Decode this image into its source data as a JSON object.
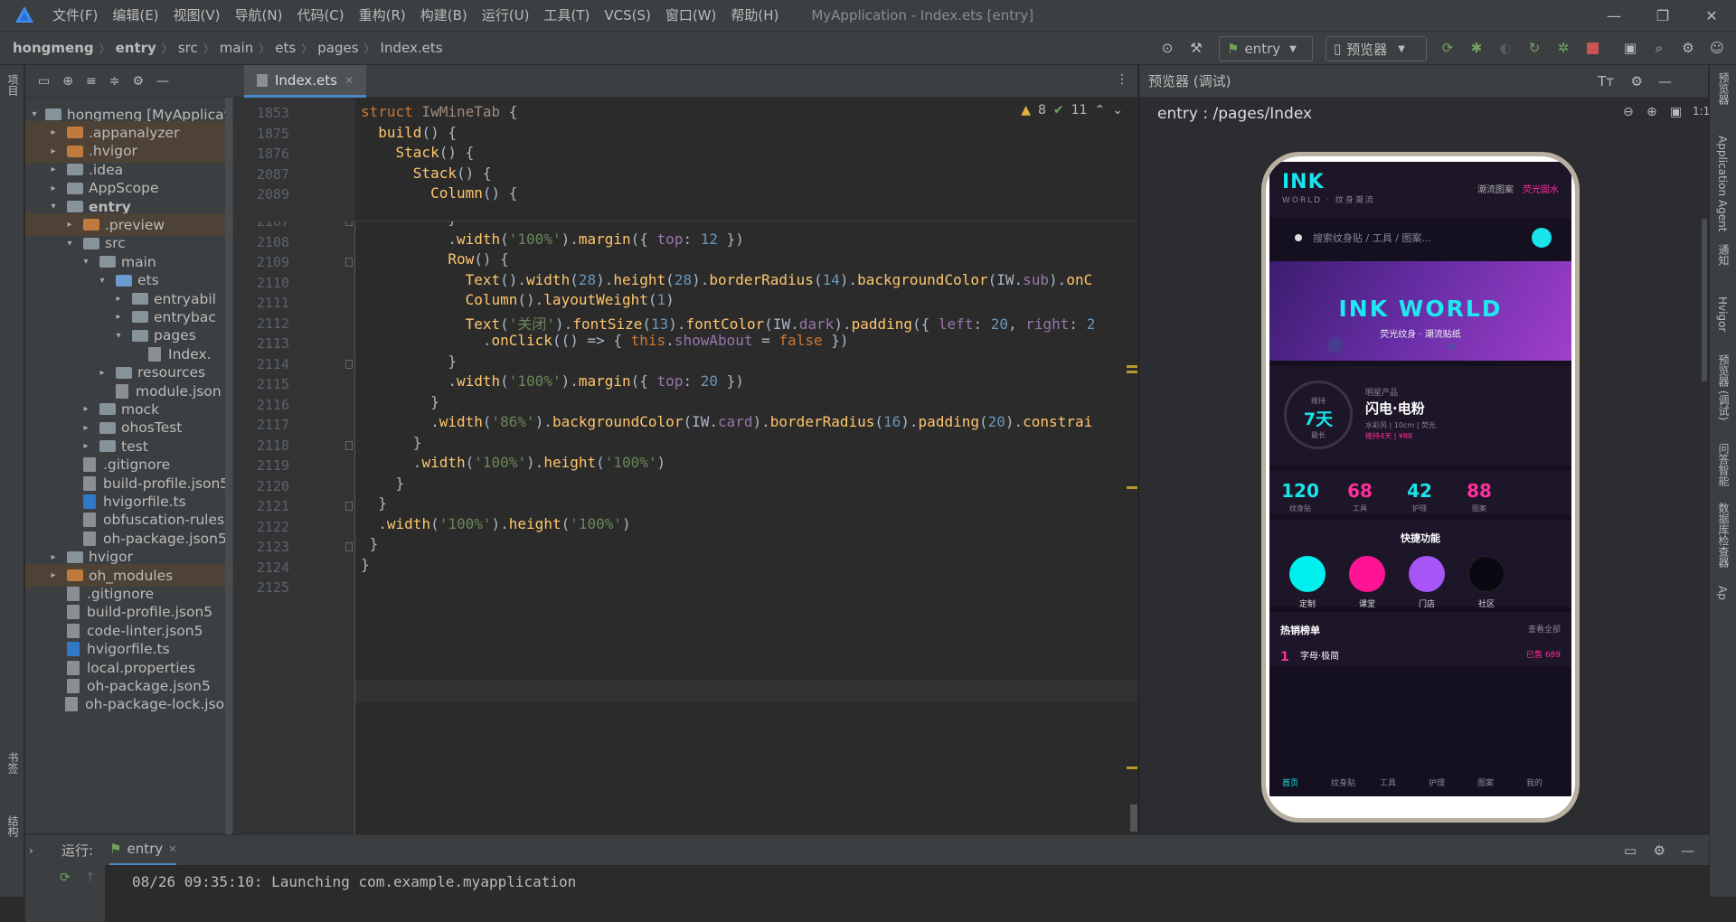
{
  "menubar": {
    "items": [
      "文件(F)",
      "编辑(E)",
      "视图(V)",
      "导航(N)",
      "代码(C)",
      "重构(R)",
      "构建(B)",
      "运行(U)",
      "工具(T)",
      "VCS(S)",
      "窗口(W)",
      "帮助(H)"
    ],
    "window_title": "MyApplication - Index.ets [entry]"
  },
  "breadcrumb": [
    "hongmeng",
    "entry",
    "src",
    "main",
    "ets",
    "pages",
    "Index.ets"
  ],
  "toolbar": {
    "config": "entry",
    "device": "预览器"
  },
  "left_strip": {
    "project": "项目",
    "bookmarks": "书签",
    "structure": "结构"
  },
  "project_tree": [
    {
      "depth": 0,
      "arrow": "▾",
      "type": "folder",
      "label": "hongmeng [MyApplicati"
    },
    {
      "depth": 1,
      "arrow": "▸",
      "type": "folder-orange",
      "label": ".appanalyzer",
      "hl": true
    },
    {
      "depth": 1,
      "arrow": "▸",
      "type": "folder-orange",
      "label": ".hvigor",
      "hl": true
    },
    {
      "depth": 1,
      "arrow": "▸",
      "type": "folder",
      "label": ".idea"
    },
    {
      "depth": 1,
      "arrow": "▸",
      "type": "folder",
      "label": "AppScope"
    },
    {
      "depth": 1,
      "arrow": "▾",
      "type": "folder",
      "label": "entry",
      "bold": true
    },
    {
      "depth": 2,
      "arrow": "▸",
      "type": "folder-orange",
      "label": ".preview",
      "hl": true
    },
    {
      "depth": 2,
      "arrow": "▾",
      "type": "folder",
      "label": "src"
    },
    {
      "depth": 3,
      "arrow": "▾",
      "type": "folder",
      "label": "main"
    },
    {
      "depth": 4,
      "arrow": "▾",
      "type": "folder-blue",
      "label": "ets"
    },
    {
      "depth": 5,
      "arrow": "▸",
      "type": "folder",
      "label": "entryabil"
    },
    {
      "depth": 5,
      "arrow": "▸",
      "type": "folder",
      "label": "entrybac"
    },
    {
      "depth": 5,
      "arrow": "▾",
      "type": "folder",
      "label": "pages"
    },
    {
      "depth": 6,
      "arrow": "",
      "type": "file",
      "label": "Index."
    },
    {
      "depth": 4,
      "arrow": "▸",
      "type": "folder",
      "label": "resources"
    },
    {
      "depth": 4,
      "arrow": "",
      "type": "file",
      "label": "module.json"
    },
    {
      "depth": 3,
      "arrow": "▸",
      "type": "folder",
      "label": "mock"
    },
    {
      "depth": 3,
      "arrow": "▸",
      "type": "folder",
      "label": "ohosTest"
    },
    {
      "depth": 3,
      "arrow": "▸",
      "type": "folder",
      "label": "test"
    },
    {
      "depth": 2,
      "arrow": "",
      "type": "file",
      "label": ".gitignore"
    },
    {
      "depth": 2,
      "arrow": "",
      "type": "file",
      "label": "build-profile.json5"
    },
    {
      "depth": 2,
      "arrow": "",
      "type": "file-ts",
      "label": "hvigorfile.ts"
    },
    {
      "depth": 2,
      "arrow": "",
      "type": "file",
      "label": "obfuscation-rules."
    },
    {
      "depth": 2,
      "arrow": "",
      "type": "file",
      "label": "oh-package.json5"
    },
    {
      "depth": 1,
      "arrow": "▸",
      "type": "folder",
      "label": "hvigor"
    },
    {
      "depth": 1,
      "arrow": "▸",
      "type": "folder-orange",
      "label": "oh_modules",
      "hl": true
    },
    {
      "depth": 1,
      "arrow": "",
      "type": "file",
      "label": ".gitignore"
    },
    {
      "depth": 1,
      "arrow": "",
      "type": "file",
      "label": "build-profile.json5"
    },
    {
      "depth": 1,
      "arrow": "",
      "type": "file",
      "label": "code-linter.json5"
    },
    {
      "depth": 1,
      "arrow": "",
      "type": "file-ts",
      "label": "hvigorfile.ts"
    },
    {
      "depth": 1,
      "arrow": "",
      "type": "file",
      "label": "local.properties"
    },
    {
      "depth": 1,
      "arrow": "",
      "type": "file",
      "label": "oh-package.json5"
    },
    {
      "depth": 1,
      "arrow": "",
      "type": "file",
      "label": "oh-package-lock.json"
    }
  ],
  "editor": {
    "tab": "Index.ets",
    "inspection": {
      "warnings": "8",
      "weak": "11"
    },
    "sticky_lines": [
      {
        "num": "1853",
        "html": "<span class='kw'>struct</span> <span class='fn' style='color:#9e8b7d'>IwMineTab</span> {"
      },
      {
        "num": "1875",
        "html": "  <span class='fn'>build</span>() {"
      },
      {
        "num": "1876",
        "html": "    <span class='fn'>Stack</span>() {"
      },
      {
        "num": "2087",
        "html": "      <span class='fn'>Stack</span>() {"
      },
      {
        "num": "2089",
        "html": "        <span class='fn'>Column</span>() {"
      }
    ],
    "lines": [
      {
        "num": "2107",
        "html": "          }"
      },
      {
        "num": "2108",
        "html": "          .<span class='fn'>width</span>(<span class='str'>'100%'</span>).<span class='fn'>margin</span>({ <span class='pur'>top</span>: <span class='num'>12</span> })"
      },
      {
        "num": "2109",
        "html": "          <span class='fn'>Row</span>() {"
      },
      {
        "num": "2110",
        "html": "            <span class='fn'>Text</span>().<span class='fn'>width</span>(<span class='num'>28</span>).<span class='fn'>height</span>(<span class='num'>28</span>).<span class='fn'>borderRadius</span>(<span class='num'>14</span>).<span class='fn'>backgroundColor</span>(IW.<span class='pur'>sub</span>).<span class='fn'>onC</span>"
      },
      {
        "num": "2111",
        "html": "            <span class='fn'>Column</span>().<span class='fn'>layoutWeight</span>(<span class='num'>1</span>)"
      },
      {
        "num": "2112",
        "html": "            <span class='fn'>Text</span>(<span class='str'>'关闭'</span>).<span class='fn'>fontSize</span>(<span class='num'>13</span>).<span class='fn'>fontColor</span>(IW.<span class='pur'>dark</span>).<span class='fn'>padding</span>({ <span class='pur'>left</span>: <span class='num'>20</span>, <span class='pur'>right</span>: <span class='num'>2</span>"
      },
      {
        "num": "2113",
        "html": "              .<span class='fn'>onClick</span>(() => { <span class='kw'>this</span>.<span class='pur'>showAbout</span> = <span class='kw'>false</span> })"
      },
      {
        "num": "2114",
        "html": "          }"
      },
      {
        "num": "2115",
        "html": "          .<span class='fn'>width</span>(<span class='str'>'100%'</span>).<span class='fn'>margin</span>({ <span class='pur'>top</span>: <span class='num'>20</span> })"
      },
      {
        "num": "2116",
        "html": "        }"
      },
      {
        "num": "2117",
        "html": "        .<span class='fn'>width</span>(<span class='str'>'86%'</span>).<span class='fn'>backgroundColor</span>(IW.<span class='pur'>card</span>).<span class='fn'>borderRadius</span>(<span class='num'>16</span>).<span class='fn'>padding</span>(<span class='num'>20</span>).<span class='fn'>constrai</span>"
      },
      {
        "num": "2118",
        "html": "      }"
      },
      {
        "num": "2119",
        "html": "      .<span class='fn'>width</span>(<span class='str'>'100%'</span>).<span class='fn'>height</span>(<span class='str'>'100%'</span>)"
      },
      {
        "num": "2120",
        "html": "    }"
      },
      {
        "num": "2121",
        "html": "  }"
      },
      {
        "num": "2122",
        "html": "  .<span class='fn'>width</span>(<span class='str'>'100%'</span>).<span class='fn'>height</span>(<span class='str'>'100%'</span>)"
      },
      {
        "num": "2123",
        "html": " }"
      },
      {
        "num": "2124",
        "html": "}"
      },
      {
        "num": "2125",
        "html": ""
      }
    ]
  },
  "preview": {
    "header": "预览器 (调试)",
    "path": "entry : /pages/Index"
  },
  "app": {
    "logo": "INK",
    "logo_sub": "WORLD · 纹身潮流",
    "header_link": "潮流图案",
    "header_badge": "荧光固水",
    "search_placeholder": "搜索纹身贴 / 工具 / 图案...",
    "banner_title": "INK WORLD",
    "banner_sub": "荧光纹身 · 潮流贴纸",
    "card": {
      "ring_top": "维持",
      "ring_value": "7天",
      "ring_bottom": "最长",
      "tag": "明星产品",
      "name": "闪电·电粉",
      "spec": "水彩风 | 10cm | 荧光",
      "promo": "维持4天 | ¥88"
    },
    "stats": [
      {
        "value": "120",
        "label": "纹身贴",
        "color": "#19e4ec"
      },
      {
        "value": "68",
        "label": "工具",
        "color": "#ff2e9a"
      },
      {
        "value": "42",
        "label": "护理",
        "color": "#19e4ec"
      },
      {
        "value": "88",
        "label": "图案",
        "color": "#ff2e9a"
      }
    ],
    "quick_title": "快捷功能",
    "quick": [
      {
        "label": "定制",
        "color": "#00f0f0"
      },
      {
        "label": "课堂",
        "color": "#ff1493"
      },
      {
        "label": "门店",
        "color": "#a855f7"
      },
      {
        "label": "社区",
        "color": "#0a0810"
      }
    ],
    "rank_title": "热销榜单",
    "rank_more": "查看全部",
    "rank_item": {
      "num": "1",
      "name": "字母·极简",
      "sold": "已售 689"
    },
    "tabs": [
      "首页",
      "纹身贴",
      "工具",
      "护理",
      "图案",
      "我的"
    ]
  },
  "right_strip": [
    "预览器",
    "Application Agent",
    "通知",
    "Hvigor",
    "预览器 (调试)",
    "问答智能",
    "数据库检查器",
    "Ap"
  ],
  "run": {
    "label": "运行:",
    "tab": "entry",
    "console": "08/26 09:35:10: Launching com.example.myapplication"
  },
  "colors": {
    "accent_cyan": "#19e4ec",
    "accent_pink": "#ff2e9a",
    "ide_bg": "#2b2b2b",
    "panel_bg": "#3c3f41"
  }
}
